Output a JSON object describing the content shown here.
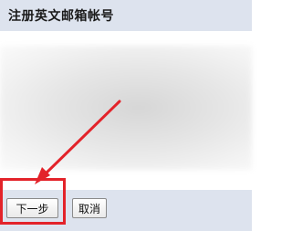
{
  "header": {
    "title": "注册英文邮箱帐号"
  },
  "footer": {
    "next_label": "下一步",
    "cancel_label": "取消"
  },
  "colors": {
    "header_bg": "#dde3ee",
    "annotation_red": "#e3232a"
  }
}
